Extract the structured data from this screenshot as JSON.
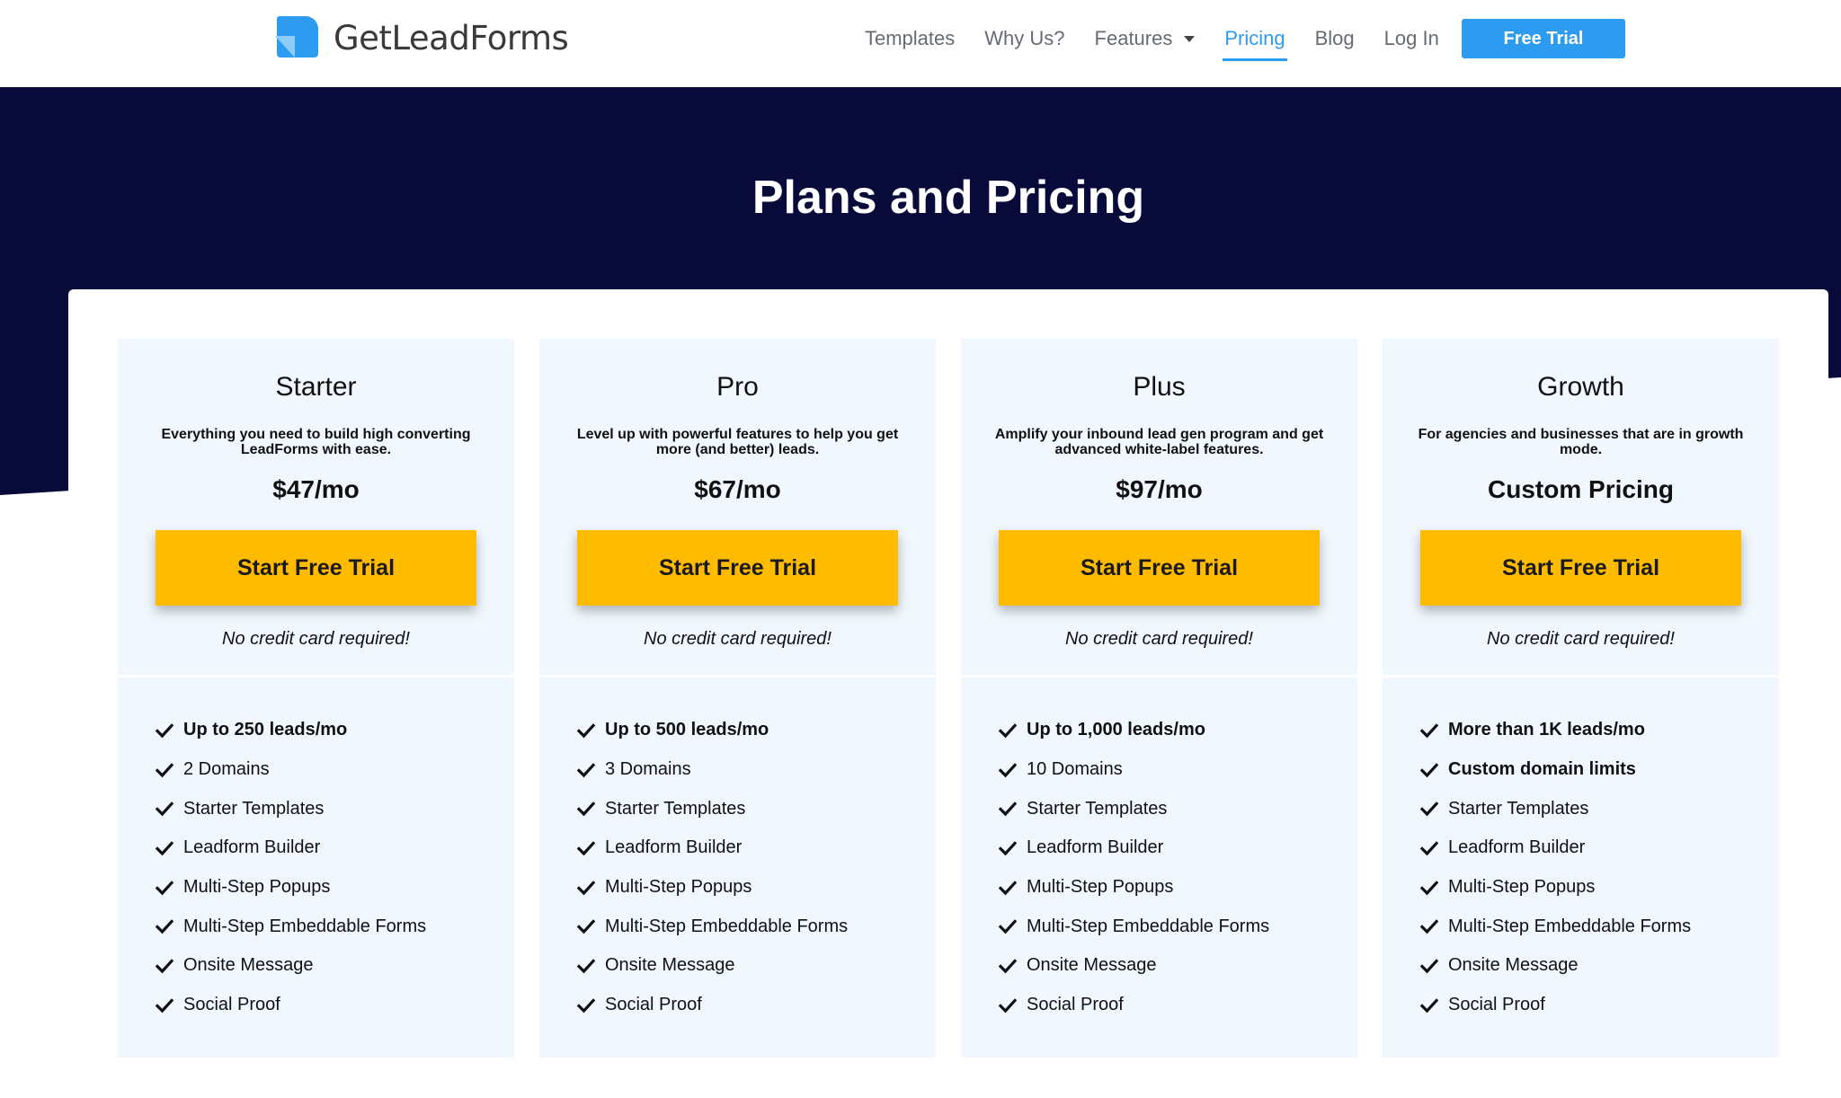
{
  "brand": {
    "name": "GetLeadForms",
    "logo_icon": "getleadforms-logo-icon",
    "primary_color": "#2d9cf0",
    "hero_color": "#080a3a",
    "cta_color": "#ffbb00",
    "card_bg": "#f0f7fe"
  },
  "nav": {
    "links": [
      "Templates",
      "Why Us?",
      "Features",
      "Pricing",
      "Blog",
      "Log In"
    ],
    "active": "Pricing",
    "cta": "Free Trial"
  },
  "hero": {
    "title": "Plans and Pricing"
  },
  "plans": [
    {
      "name": "Starter",
      "description": "Everything you need to build high converting LeadForms with ease.",
      "price": "$47/mo",
      "button": "Start Free Trial",
      "note": "No credit card required!",
      "features": [
        {
          "text": "Up to 250 leads/mo",
          "bold": true
        },
        {
          "text": "2 Domains",
          "bold": false
        },
        {
          "text": "Starter Templates",
          "bold": false
        },
        {
          "text": "Leadform Builder",
          "bold": false
        },
        {
          "text": "Multi-Step Popups",
          "bold": false
        },
        {
          "text": "Multi-Step Embeddable Forms",
          "bold": false
        },
        {
          "text": "Onsite Message",
          "bold": false
        },
        {
          "text": "Social Proof",
          "bold": false
        }
      ]
    },
    {
      "name": "Pro",
      "description": "Level up with powerful features to help you get more (and better) leads.",
      "price": "$67/mo",
      "button": "Start Free Trial",
      "note": "No credit card required!",
      "features": [
        {
          "text": "Up to 500 leads/mo",
          "bold": true
        },
        {
          "text": "3 Domains",
          "bold": false
        },
        {
          "text": "Starter Templates",
          "bold": false
        },
        {
          "text": "Leadform Builder",
          "bold": false
        },
        {
          "text": "Multi-Step Popups",
          "bold": false
        },
        {
          "text": "Multi-Step Embeddable Forms",
          "bold": false
        },
        {
          "text": "Onsite Message",
          "bold": false
        },
        {
          "text": "Social Proof",
          "bold": false
        }
      ]
    },
    {
      "name": "Plus",
      "description": "Amplify your inbound lead gen program and get advanced white-label features.",
      "price": "$97/mo",
      "button": "Start Free Trial",
      "note": "No credit card required!",
      "features": [
        {
          "text": "Up to 1,000 leads/mo",
          "bold": true
        },
        {
          "text": "10 Domains",
          "bold": false
        },
        {
          "text": "Starter Templates",
          "bold": false
        },
        {
          "text": "Leadform Builder",
          "bold": false
        },
        {
          "text": "Multi-Step Popups",
          "bold": false
        },
        {
          "text": "Multi-Step Embeddable Forms",
          "bold": false
        },
        {
          "text": "Onsite Message",
          "bold": false
        },
        {
          "text": "Social Proof",
          "bold": false
        }
      ]
    },
    {
      "name": "Growth",
      "description": "For agencies and businesses that are in growth mode.",
      "price": "Custom Pricing",
      "button": "Start Free Trial",
      "note": "No credit card required!",
      "features": [
        {
          "text": "More than 1K leads/mo",
          "bold": true
        },
        {
          "text": "Custom domain limits",
          "bold": true
        },
        {
          "text": "Starter Templates",
          "bold": false
        },
        {
          "text": "Leadform Builder",
          "bold": false
        },
        {
          "text": "Multi-Step Popups",
          "bold": false
        },
        {
          "text": "Multi-Step Embeddable Forms",
          "bold": false
        },
        {
          "text": "Onsite Message",
          "bold": false
        },
        {
          "text": "Social Proof",
          "bold": false
        }
      ]
    }
  ]
}
